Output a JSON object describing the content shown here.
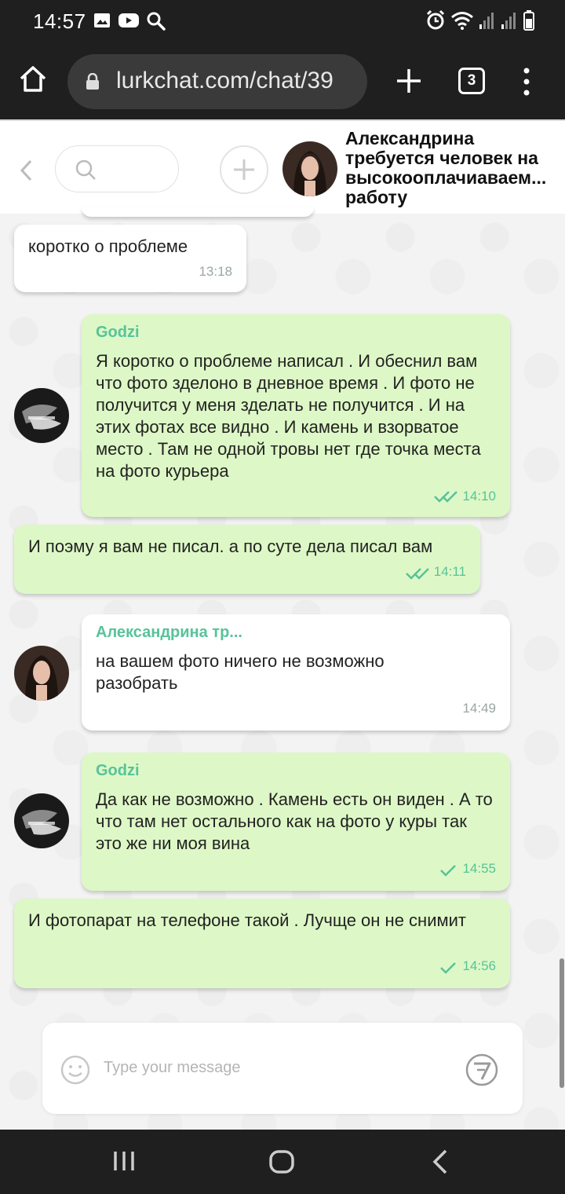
{
  "status_bar": {
    "time": "14:57",
    "left_icons": [
      "image-icon",
      "youtube-icon",
      "search-icon"
    ],
    "right_icons": [
      "alarm-icon",
      "wifi-icon",
      "signal-icon",
      "signal-icon",
      "battery-icon"
    ]
  },
  "browser": {
    "url": "lurkchat.com/chat/39",
    "tab_count": "3"
  },
  "chat_header": {
    "title": "Александрина требуется человек на высокооплачиаваем... работу"
  },
  "messages": [
    {
      "side": "white",
      "sender": "",
      "text": "коротко о проблеме",
      "time": "13:18",
      "status": ""
    },
    {
      "side": "green",
      "sender": "Godzi",
      "text": "Я коротко о проблеме написал . И обеснил вам что фото зделоно в дневное время . И фото не получится у меня зделать не получится . И на этих фотах все видно . И камень и взорватое место . Там не одной тровы нет где точка места на фото курьера",
      "time": "14:10",
      "status": "read"
    },
    {
      "side": "green",
      "sender": "",
      "text": "И поэму я вам не писал. а по суте дела писал вам",
      "time": "14:11",
      "status": "read"
    },
    {
      "side": "white",
      "sender": "Александрина тр...",
      "text": "на вашем фото ничего не возможно разобрать",
      "time": "14:49",
      "status": ""
    },
    {
      "side": "green",
      "sender": "Godzi",
      "text": "Да как не возможно . Камень есть он виден . А то что там нет остального как на фото у куры так это же ни моя вина",
      "time": "14:55",
      "status": "sent"
    },
    {
      "side": "green",
      "sender": "",
      "text": "И фотопарат на телефоне такой . Лучще он не снимит",
      "time": "14:56",
      "status": "sent"
    }
  ],
  "composer": {
    "placeholder": "Type your message"
  },
  "colors": {
    "accent": "#57c39a",
    "green_bubble": "#ddf8c6",
    "chrome": "#1f1f1f"
  }
}
